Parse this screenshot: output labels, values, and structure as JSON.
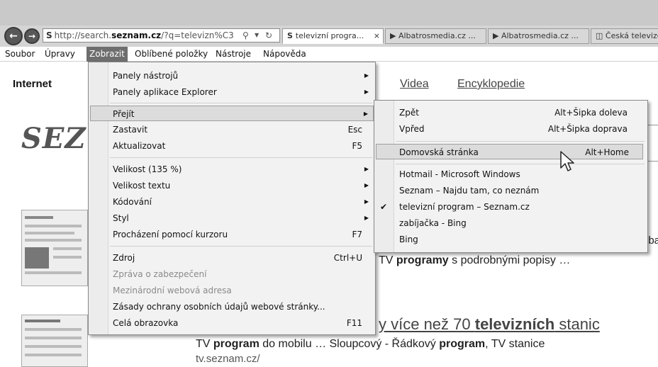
{
  "browser": {
    "address": {
      "prefix": "http://search.",
      "host": "seznam.cz",
      "rest": "/?q=televizn%C3"
    },
    "tabs": [
      {
        "label": "televizní progra...",
        "close": "×",
        "active": true
      },
      {
        "label": "Albatrosmedia.cz ...",
        "active": false
      },
      {
        "label": "Albatrosmedia.cz ...",
        "active": false
      },
      {
        "label": "Česká televize",
        "active": false
      }
    ]
  },
  "menubar": [
    "Soubor",
    "Úpravy",
    "Zobrazit",
    "Oblíbené položky",
    "Nástroje",
    "Nápověda"
  ],
  "view_menu": {
    "items": [
      {
        "label": "Panely nástrojů",
        "shortcut": "",
        "submenu": true
      },
      {
        "label": "Panely aplikace Explorer",
        "shortcut": "",
        "submenu": true
      },
      {
        "label": "Přejít",
        "shortcut": "",
        "submenu": true,
        "highlight": true
      },
      {
        "label": "Zastavit",
        "shortcut": "Esc"
      },
      {
        "label": "Aktualizovat",
        "shortcut": "F5"
      },
      {
        "label": "Velikost (135 %)",
        "shortcut": "",
        "submenu": true
      },
      {
        "label": "Velikost textu",
        "shortcut": "",
        "submenu": true
      },
      {
        "label": "Kódování",
        "shortcut": "",
        "submenu": true
      },
      {
        "label": "Styl",
        "shortcut": "",
        "submenu": true
      },
      {
        "label": "Procházení pomocí kurzoru",
        "shortcut": "F7"
      },
      {
        "label": "Zdroj",
        "shortcut": "Ctrl+U"
      },
      {
        "label": "Zpráva o zabezpečení",
        "shortcut": "",
        "disabled": true
      },
      {
        "label": "Mezinárodní webová adresa",
        "shortcut": "",
        "disabled": true
      },
      {
        "label": "Zásady ochrany osobních údajů webové stránky...",
        "shortcut": ""
      },
      {
        "label": "Celá obrazovka",
        "shortcut": "F11"
      }
    ]
  },
  "goto_menu": {
    "items": [
      {
        "label": "Zpět",
        "shortcut": "Alt+Šipka doleva"
      },
      {
        "label": "Vpřed",
        "shortcut": "Alt+Šipka doprava"
      },
      {
        "label": "Domovská stránka",
        "shortcut": "Alt+Home",
        "highlight": true
      },
      {
        "label": "Hotmail - Microsoft Windows",
        "shortcut": ""
      },
      {
        "label": "Seznam – Najdu tam, co neznám",
        "shortcut": ""
      },
      {
        "label": "televizní program – Seznam.cz",
        "shortcut": "",
        "checked": true
      },
      {
        "label": "zabíjačka - Bing",
        "shortcut": ""
      },
      {
        "label": "Bing",
        "shortcut": ""
      }
    ]
  },
  "page": {
    "internet_label": "Internet",
    "nav_videa": "Videa",
    "nav_encyklopedie": "Encyklopedie",
    "logo_text": "SEZ",
    "result1": {
      "cut": "dba",
      "pre": "TV ",
      "bold": "programy",
      "post": " s podrobnými popisy …"
    },
    "result2": {
      "title_pre": "y více než 70 ",
      "title_bold": "televizních",
      "title_post": " stanic",
      "snip_a": "TV ",
      "snip_b": "program",
      "snip_c": " do mobilu … Sloupcový - Řádkový ",
      "snip_d": "program",
      "snip_e": ", TV stanice",
      "url": "tv.seznam.cz/"
    }
  },
  "colors": {
    "menu_highlight": "#dcdcdc",
    "menubar_active": "#6e6e6e"
  }
}
